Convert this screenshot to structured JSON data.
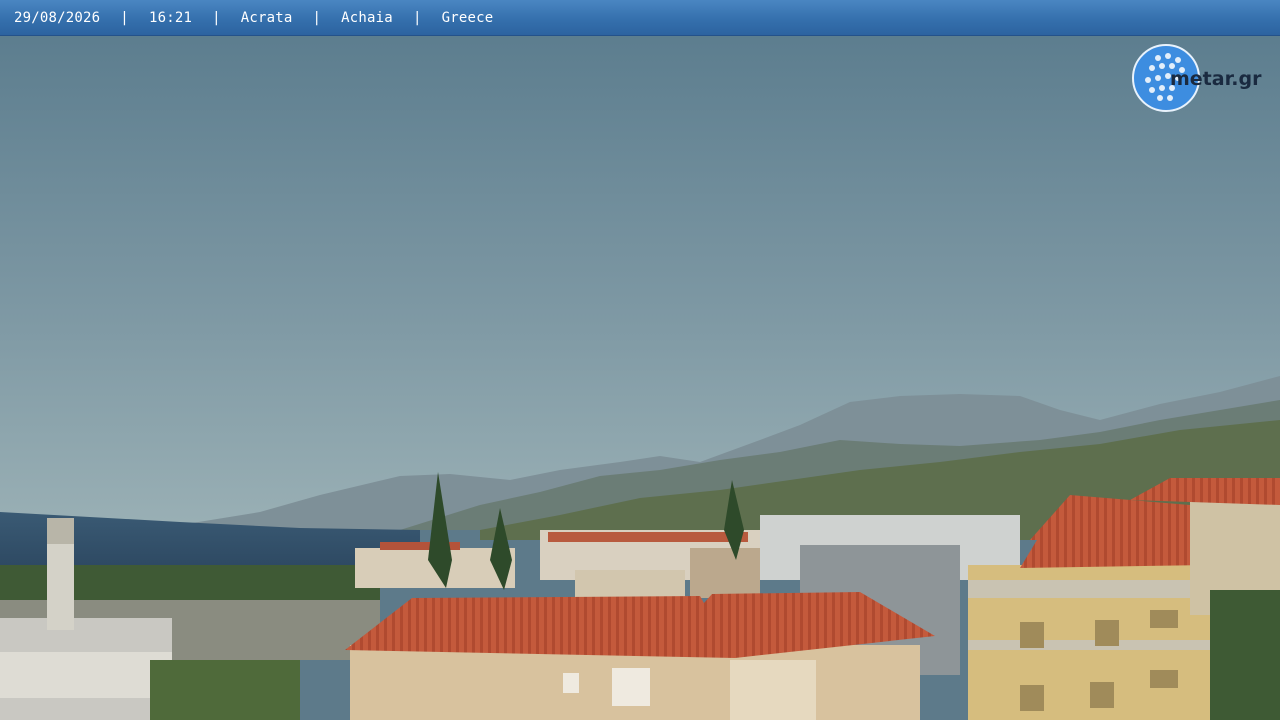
{
  "overlay": {
    "date": "29/08/2026",
    "time": "16:21",
    "place": "Acrata",
    "region": "Achaia",
    "country": "Greece",
    "separator": "|"
  },
  "logo": {
    "text": "metar.gr",
    "icon": "golf-ball-globe-icon"
  },
  "colors": {
    "bar": "#3570ad",
    "sky_top": "#5b7b8c",
    "sky_horizon": "#8fa6ae",
    "sea": "#2f4c66",
    "roof": "#c4563a"
  }
}
